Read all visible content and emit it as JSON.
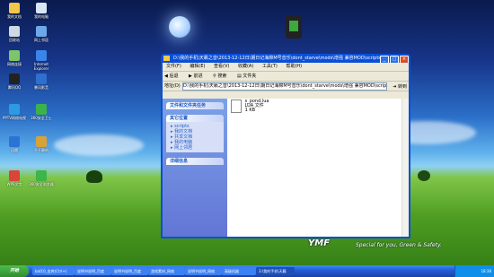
{
  "desktop": {
    "icons": [
      {
        "label": "我的文档",
        "color": "#f2c64a"
      },
      {
        "label": "我的电脑",
        "color": "#d8e6f6"
      },
      {
        "label": "回收站",
        "color": "#cfd9e3"
      },
      {
        "label": "网上邻居",
        "color": "#6fa8e8"
      },
      {
        "label": "网络连接",
        "color": "#7cc56a"
      },
      {
        "label": "Internet Explorer",
        "color": "#3b84e8"
      },
      {
        "label": "腾讯QQ",
        "color": "#222222"
      },
      {
        "label": "暴风影音",
        "color": "#2f6fcf"
      },
      {
        "label": "PPTV网络电视",
        "color": "#2d9be0"
      },
      {
        "label": "360安全卫士",
        "color": "#3bb34a"
      },
      {
        "label": "迅雷",
        "color": "#2b74d6"
      },
      {
        "label": "千千静听",
        "color": "#d8a23a"
      },
      {
        "label": "WPS文字",
        "color": "#d9453a"
      },
      {
        "label": "360安全浏览器",
        "color": "#3db548"
      }
    ],
    "brand_logo": "YMF",
    "tagline": "Special for you, Green & Safety."
  },
  "window": {
    "title": "D:\\我的手机\\天籁之音\\2013-12-12日\\期日记海棉M号音乐\\dont_starve\\mods\\增强 兼容MOD\\scripts\\pr...",
    "menu": [
      "文件(F)",
      "编辑(E)",
      "查看(V)",
      "收藏(A)",
      "工具(T)",
      "帮助(H)"
    ],
    "toolbar": [
      "后退",
      "前进",
      "搜索",
      "文件夹"
    ],
    "address_label": "地址(D)",
    "address": "D:\\我的手机\\天籁之音\\2013-12-12日\\期日记海棉M号音乐\\dont_starve\\mods\\增强 兼容MOD\\scripts\\prefabs",
    "go_label": "转到",
    "panels": [
      {
        "title": "文件和文件夹任务",
        "items": []
      },
      {
        "title": "其它位置",
        "items": [
          "scripts",
          "我的文档",
          "共享文档",
          "我的电脑",
          "网上邻居"
        ]
      },
      {
        "title": "详细信息",
        "items": []
      }
    ],
    "file": {
      "name": "s_pond.lua",
      "type": "LUA 文件",
      "size": "1 KB"
    }
  },
  "taskbar": {
    "start_label": "开始",
    "items": [
      "bat10_金库(Ctrl+)",
      "说明书说明_百度",
      "说明书说明_百度",
      "游戏素材_网络",
      "说明书说明_网络",
      "高级机器",
      "3:\\我的手机\\天籁"
    ],
    "clock": "18:38"
  }
}
